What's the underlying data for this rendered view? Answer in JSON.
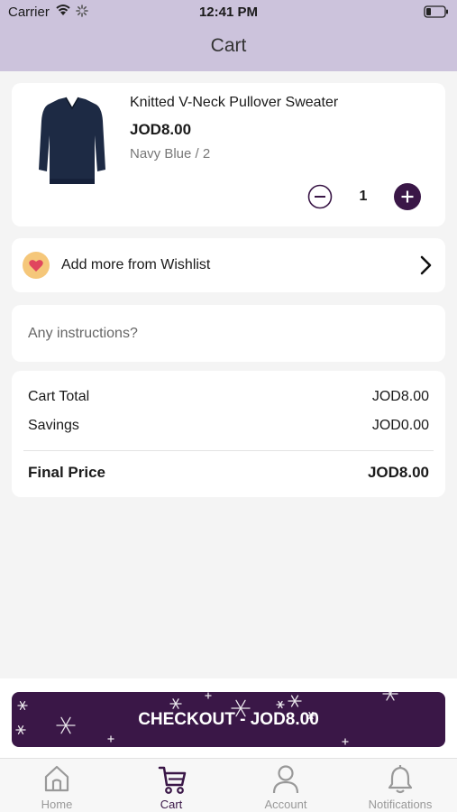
{
  "status_bar": {
    "carrier": "Carrier",
    "time": "12:41 PM"
  },
  "header": {
    "title": "Cart"
  },
  "cart_item": {
    "name": "Knitted V-Neck Pullover Sweater",
    "price": "JOD8.00",
    "variant": "Navy Blue / 2",
    "quantity": "1"
  },
  "wishlist": {
    "label": "Add more from Wishlist"
  },
  "instructions": {
    "placeholder": "Any instructions?"
  },
  "totals": {
    "cart_total_label": "Cart Total",
    "cart_total_value": "JOD8.00",
    "savings_label": "Savings",
    "savings_value": "JOD0.00",
    "final_label": "Final Price",
    "final_value": "JOD8.00"
  },
  "checkout": {
    "label": "CHECKOUT - JOD8.00"
  },
  "tabs": [
    {
      "label": "Home",
      "icon": "home-icon"
    },
    {
      "label": "Cart",
      "icon": "cart-icon"
    },
    {
      "label": "Account",
      "icon": "account-icon"
    },
    {
      "label": "Notifications",
      "icon": "bell-icon"
    }
  ],
  "colors": {
    "header_bg": "#ccc3dc",
    "accent": "#3a1747",
    "inactive_tab": "#999999"
  }
}
